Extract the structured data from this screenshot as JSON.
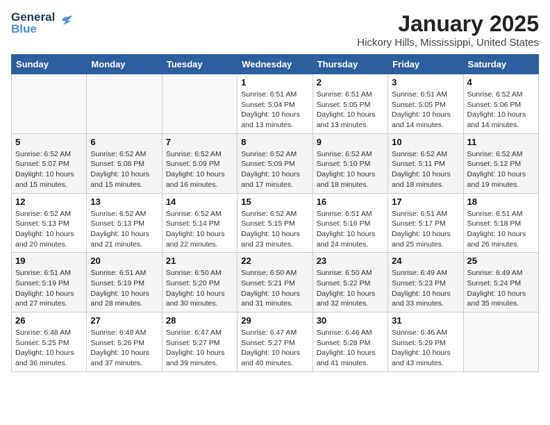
{
  "logo": {
    "line1": "General",
    "line2": "Blue"
  },
  "title": "January 2025",
  "subtitle": "Hickory Hills, Mississippi, United States",
  "days_of_week": [
    "Sunday",
    "Monday",
    "Tuesday",
    "Wednesday",
    "Thursday",
    "Friday",
    "Saturday"
  ],
  "weeks": [
    [
      {
        "day": "",
        "info": ""
      },
      {
        "day": "",
        "info": ""
      },
      {
        "day": "",
        "info": ""
      },
      {
        "day": "1",
        "info": "Sunrise: 6:51 AM\nSunset: 5:04 PM\nDaylight: 10 hours\nand 13 minutes."
      },
      {
        "day": "2",
        "info": "Sunrise: 6:51 AM\nSunset: 5:05 PM\nDaylight: 10 hours\nand 13 minutes."
      },
      {
        "day": "3",
        "info": "Sunrise: 6:51 AM\nSunset: 5:05 PM\nDaylight: 10 hours\nand 14 minutes."
      },
      {
        "day": "4",
        "info": "Sunrise: 6:52 AM\nSunset: 5:06 PM\nDaylight: 10 hours\nand 14 minutes."
      }
    ],
    [
      {
        "day": "5",
        "info": "Sunrise: 6:52 AM\nSunset: 5:07 PM\nDaylight: 10 hours\nand 15 minutes."
      },
      {
        "day": "6",
        "info": "Sunrise: 6:52 AM\nSunset: 5:08 PM\nDaylight: 10 hours\nand 15 minutes."
      },
      {
        "day": "7",
        "info": "Sunrise: 6:52 AM\nSunset: 5:09 PM\nDaylight: 10 hours\nand 16 minutes."
      },
      {
        "day": "8",
        "info": "Sunrise: 6:52 AM\nSunset: 5:09 PM\nDaylight: 10 hours\nand 17 minutes."
      },
      {
        "day": "9",
        "info": "Sunrise: 6:52 AM\nSunset: 5:10 PM\nDaylight: 10 hours\nand 18 minutes."
      },
      {
        "day": "10",
        "info": "Sunrise: 6:52 AM\nSunset: 5:11 PM\nDaylight: 10 hours\nand 18 minutes."
      },
      {
        "day": "11",
        "info": "Sunrise: 6:52 AM\nSunset: 5:12 PM\nDaylight: 10 hours\nand 19 minutes."
      }
    ],
    [
      {
        "day": "12",
        "info": "Sunrise: 6:52 AM\nSunset: 5:13 PM\nDaylight: 10 hours\nand 20 minutes."
      },
      {
        "day": "13",
        "info": "Sunrise: 6:52 AM\nSunset: 5:13 PM\nDaylight: 10 hours\nand 21 minutes."
      },
      {
        "day": "14",
        "info": "Sunrise: 6:52 AM\nSunset: 5:14 PM\nDaylight: 10 hours\nand 22 minutes."
      },
      {
        "day": "15",
        "info": "Sunrise: 6:52 AM\nSunset: 5:15 PM\nDaylight: 10 hours\nand 23 minutes."
      },
      {
        "day": "16",
        "info": "Sunrise: 6:51 AM\nSunset: 5:16 PM\nDaylight: 10 hours\nand 24 minutes."
      },
      {
        "day": "17",
        "info": "Sunrise: 6:51 AM\nSunset: 5:17 PM\nDaylight: 10 hours\nand 25 minutes."
      },
      {
        "day": "18",
        "info": "Sunrise: 6:51 AM\nSunset: 5:18 PM\nDaylight: 10 hours\nand 26 minutes."
      }
    ],
    [
      {
        "day": "19",
        "info": "Sunrise: 6:51 AM\nSunset: 5:19 PM\nDaylight: 10 hours\nand 27 minutes."
      },
      {
        "day": "20",
        "info": "Sunrise: 6:51 AM\nSunset: 5:19 PM\nDaylight: 10 hours\nand 28 minutes."
      },
      {
        "day": "21",
        "info": "Sunrise: 6:50 AM\nSunset: 5:20 PM\nDaylight: 10 hours\nand 30 minutes."
      },
      {
        "day": "22",
        "info": "Sunrise: 6:50 AM\nSunset: 5:21 PM\nDaylight: 10 hours\nand 31 minutes."
      },
      {
        "day": "23",
        "info": "Sunrise: 6:50 AM\nSunset: 5:22 PM\nDaylight: 10 hours\nand 32 minutes."
      },
      {
        "day": "24",
        "info": "Sunrise: 6:49 AM\nSunset: 5:23 PM\nDaylight: 10 hours\nand 33 minutes."
      },
      {
        "day": "25",
        "info": "Sunrise: 6:49 AM\nSunset: 5:24 PM\nDaylight: 10 hours\nand 35 minutes."
      }
    ],
    [
      {
        "day": "26",
        "info": "Sunrise: 6:48 AM\nSunset: 5:25 PM\nDaylight: 10 hours\nand 36 minutes."
      },
      {
        "day": "27",
        "info": "Sunrise: 6:48 AM\nSunset: 5:26 PM\nDaylight: 10 hours\nand 37 minutes."
      },
      {
        "day": "28",
        "info": "Sunrise: 6:47 AM\nSunset: 5:27 PM\nDaylight: 10 hours\nand 39 minutes."
      },
      {
        "day": "29",
        "info": "Sunrise: 6:47 AM\nSunset: 5:27 PM\nDaylight: 10 hours\nand 40 minutes."
      },
      {
        "day": "30",
        "info": "Sunrise: 6:46 AM\nSunset: 5:28 PM\nDaylight: 10 hours\nand 41 minutes."
      },
      {
        "day": "31",
        "info": "Sunrise: 6:46 AM\nSunset: 5:29 PM\nDaylight: 10 hours\nand 43 minutes."
      },
      {
        "day": "",
        "info": ""
      }
    ]
  ]
}
